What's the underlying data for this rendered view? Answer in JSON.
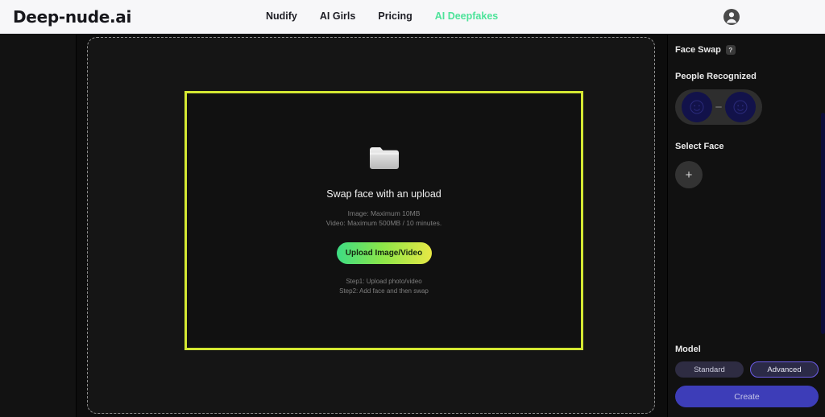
{
  "header": {
    "logo": "Deep-nude.ai",
    "nav": [
      {
        "label": "Nudify",
        "active": false
      },
      {
        "label": "AI Girls",
        "active": false
      },
      {
        "label": "Pricing",
        "active": false
      },
      {
        "label": "AI Deepfakes",
        "active": true
      }
    ],
    "avatar_icon": "user-avatar-icon",
    "accent_color": "#4ee39a",
    "background": "#f7f7f9"
  },
  "main": {
    "folder_icon": "folder-icon",
    "upload_title": "Swap face with an upload",
    "limits": [
      "Image: Maximum 10MB",
      "Video: Maximum 500MB / 10 minutes."
    ],
    "upload_button": "Upload Image/Video",
    "steps": [
      "Step1: Upload photo/video",
      "Step2: Add face and then swap"
    ],
    "frame_border_color": "#d4e832",
    "button_gradient_start": "#3ddc84",
    "button_gradient_end": "#e8e845"
  },
  "sidebar": {
    "title": "Face Swap",
    "help_icon": "question-mark-icon",
    "help_label": "?",
    "people_recognized_label": "People Recognized",
    "faces": [
      {
        "name": "face-thumb-1",
        "icon": "smiley-face-icon"
      },
      {
        "name": "face-thumb-2",
        "icon": "smiley-face-icon"
      }
    ],
    "select_face_label": "Select Face",
    "add_face_icon": "plus-icon",
    "add_face_label": "+",
    "model_label": "Model",
    "models": [
      {
        "label": "Standard",
        "selected": false
      },
      {
        "label": "Advanced",
        "selected": true
      }
    ],
    "create_button": "Create",
    "create_color": "#3d3db8",
    "selected_border_color": "#6c5ce7"
  }
}
